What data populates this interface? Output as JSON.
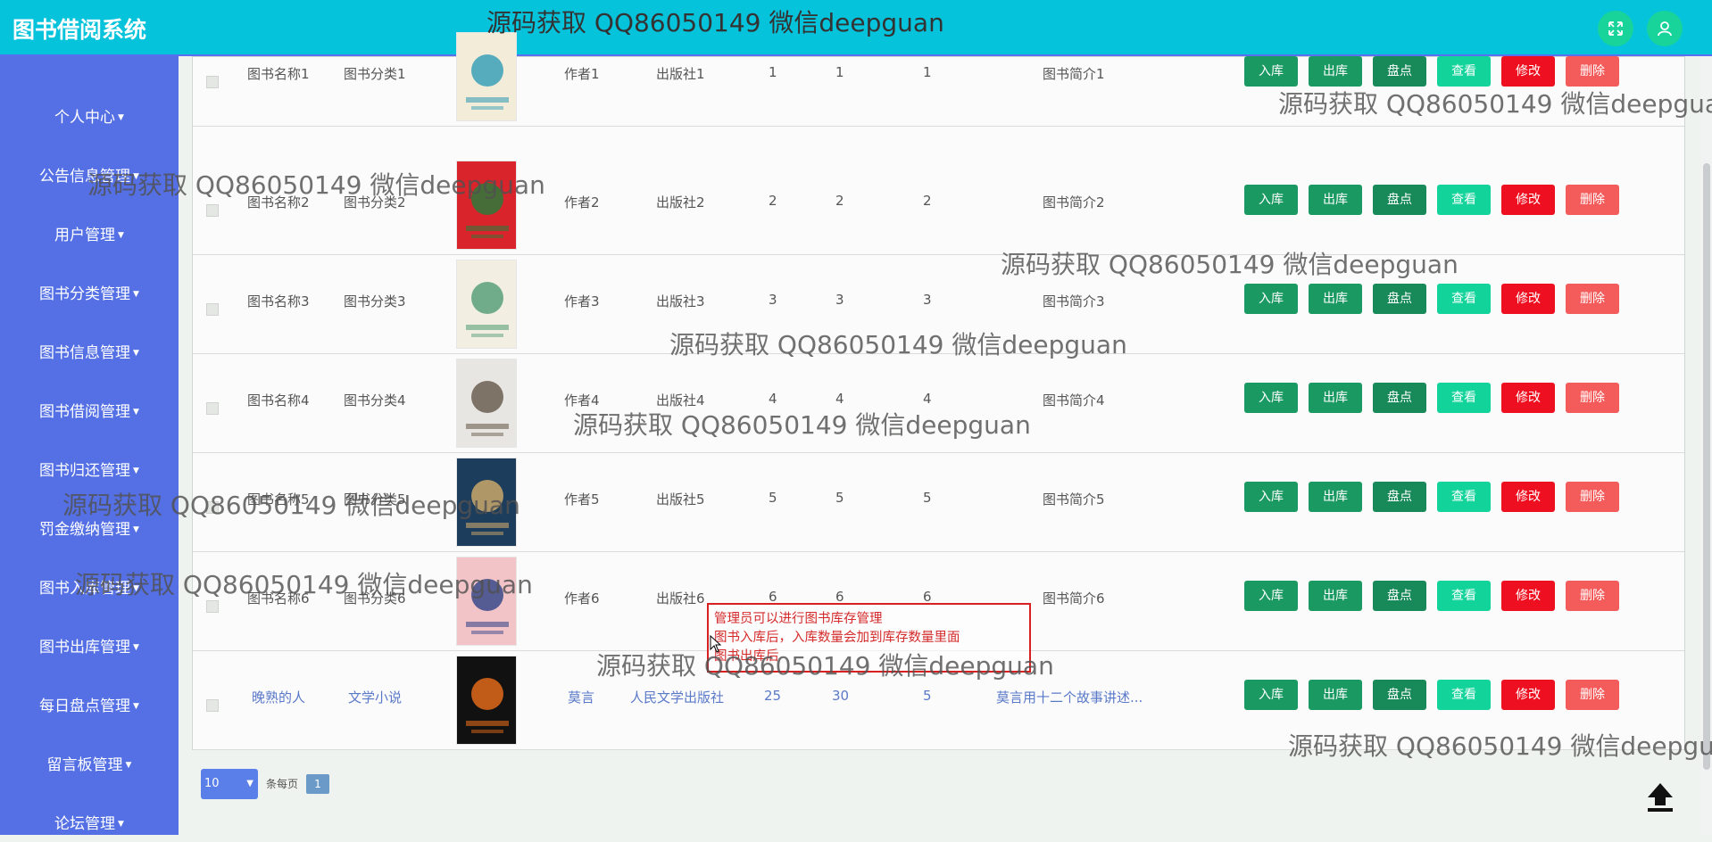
{
  "app": {
    "title": "图书借阅系统"
  },
  "header": {
    "fullscreen_icon": "expand-icon",
    "user_icon": "user-icon"
  },
  "watermark": "源码获取 QQ86050149 微信deepguan",
  "sidebar": {
    "items": [
      {
        "label": "个人中心"
      },
      {
        "label": "公告信息管理"
      },
      {
        "label": "用户管理"
      },
      {
        "label": "图书分类管理"
      },
      {
        "label": "图书信息管理"
      },
      {
        "label": "图书借阅管理"
      },
      {
        "label": "图书归还管理"
      },
      {
        "label": "罚金缴纳管理"
      },
      {
        "label": "图书入库管理"
      },
      {
        "label": "图书出库管理"
      },
      {
        "label": "每日盘点管理"
      },
      {
        "label": "留言板管理"
      },
      {
        "label": "论坛管理"
      }
    ]
  },
  "actions": {
    "in": "入库",
    "out": "出库",
    "check": "盘点",
    "view": "查看",
    "edit": "修改",
    "delete": "删除"
  },
  "rows": [
    {
      "name": "图书名称1",
      "category": "图书分类1",
      "author": "作者1",
      "publisher": "出版社1",
      "n1": "1",
      "n2": "1",
      "n3": "1",
      "intro": "图书简介1",
      "cover_bg": "#f3ecd8",
      "cover_fg": "#3aa0b8"
    },
    {
      "name": "图书名称2",
      "category": "图书分类2",
      "author": "作者2",
      "publisher": "出版社2",
      "n1": "2",
      "n2": "2",
      "n3": "2",
      "intro": "图书简介2",
      "cover_bg": "#d8242a",
      "cover_fg": "#2d7a3a"
    },
    {
      "name": "图书名称3",
      "category": "图书分类3",
      "author": "作者3",
      "publisher": "出版社3",
      "n1": "3",
      "n2": "3",
      "n3": "3",
      "intro": "图书简介3",
      "cover_bg": "#f2efe2",
      "cover_fg": "#5aa07a"
    },
    {
      "name": "图书名称4",
      "category": "图书分类4",
      "author": "作者4",
      "publisher": "出版社4",
      "n1": "4",
      "n2": "4",
      "n3": "4",
      "intro": "图书简介4",
      "cover_bg": "#e8e6e2",
      "cover_fg": "#6a5e50"
    },
    {
      "name": "图书名称5",
      "category": "图书分类5",
      "author": "作者5",
      "publisher": "出版社5",
      "n1": "5",
      "n2": "5",
      "n3": "5",
      "intro": "图书简介5",
      "cover_bg": "#1d3d5c",
      "cover_fg": "#c9a76a"
    },
    {
      "name": "图书名称6",
      "category": "图书分类6",
      "author": "作者6",
      "publisher": "出版社6",
      "n1": "6",
      "n2": "6",
      "n3": "6",
      "intro": "图书简介6",
      "cover_bg": "#f2c4c8",
      "cover_fg": "#3a4a8a"
    },
    {
      "name": "晚熟的人",
      "category": "文学小说",
      "author": "莫言",
      "publisher": "人民文学出版社",
      "n1": "25",
      "n2": "30",
      "n3": "5",
      "intro": "莫言用十二个故事讲述...",
      "cover_bg": "#111111",
      "cover_fg": "#e06a1a",
      "link": true
    }
  ],
  "note": {
    "line1": "管理员可以进行图书库存管理",
    "line2": "图书入库后，入库数量会加到库存数量里面",
    "line3": "图书出库后"
  },
  "pagination": {
    "page_size": "10",
    "per_page_label": "条每页",
    "current_page": "1"
  },
  "colors": {
    "header": "#06c3dc",
    "sidebar": "#5470e4",
    "btn_green": "#1a9a62",
    "btn_teal": "#12d39a",
    "btn_red": "#ee1020",
    "btn_pink": "#f45c5c"
  }
}
